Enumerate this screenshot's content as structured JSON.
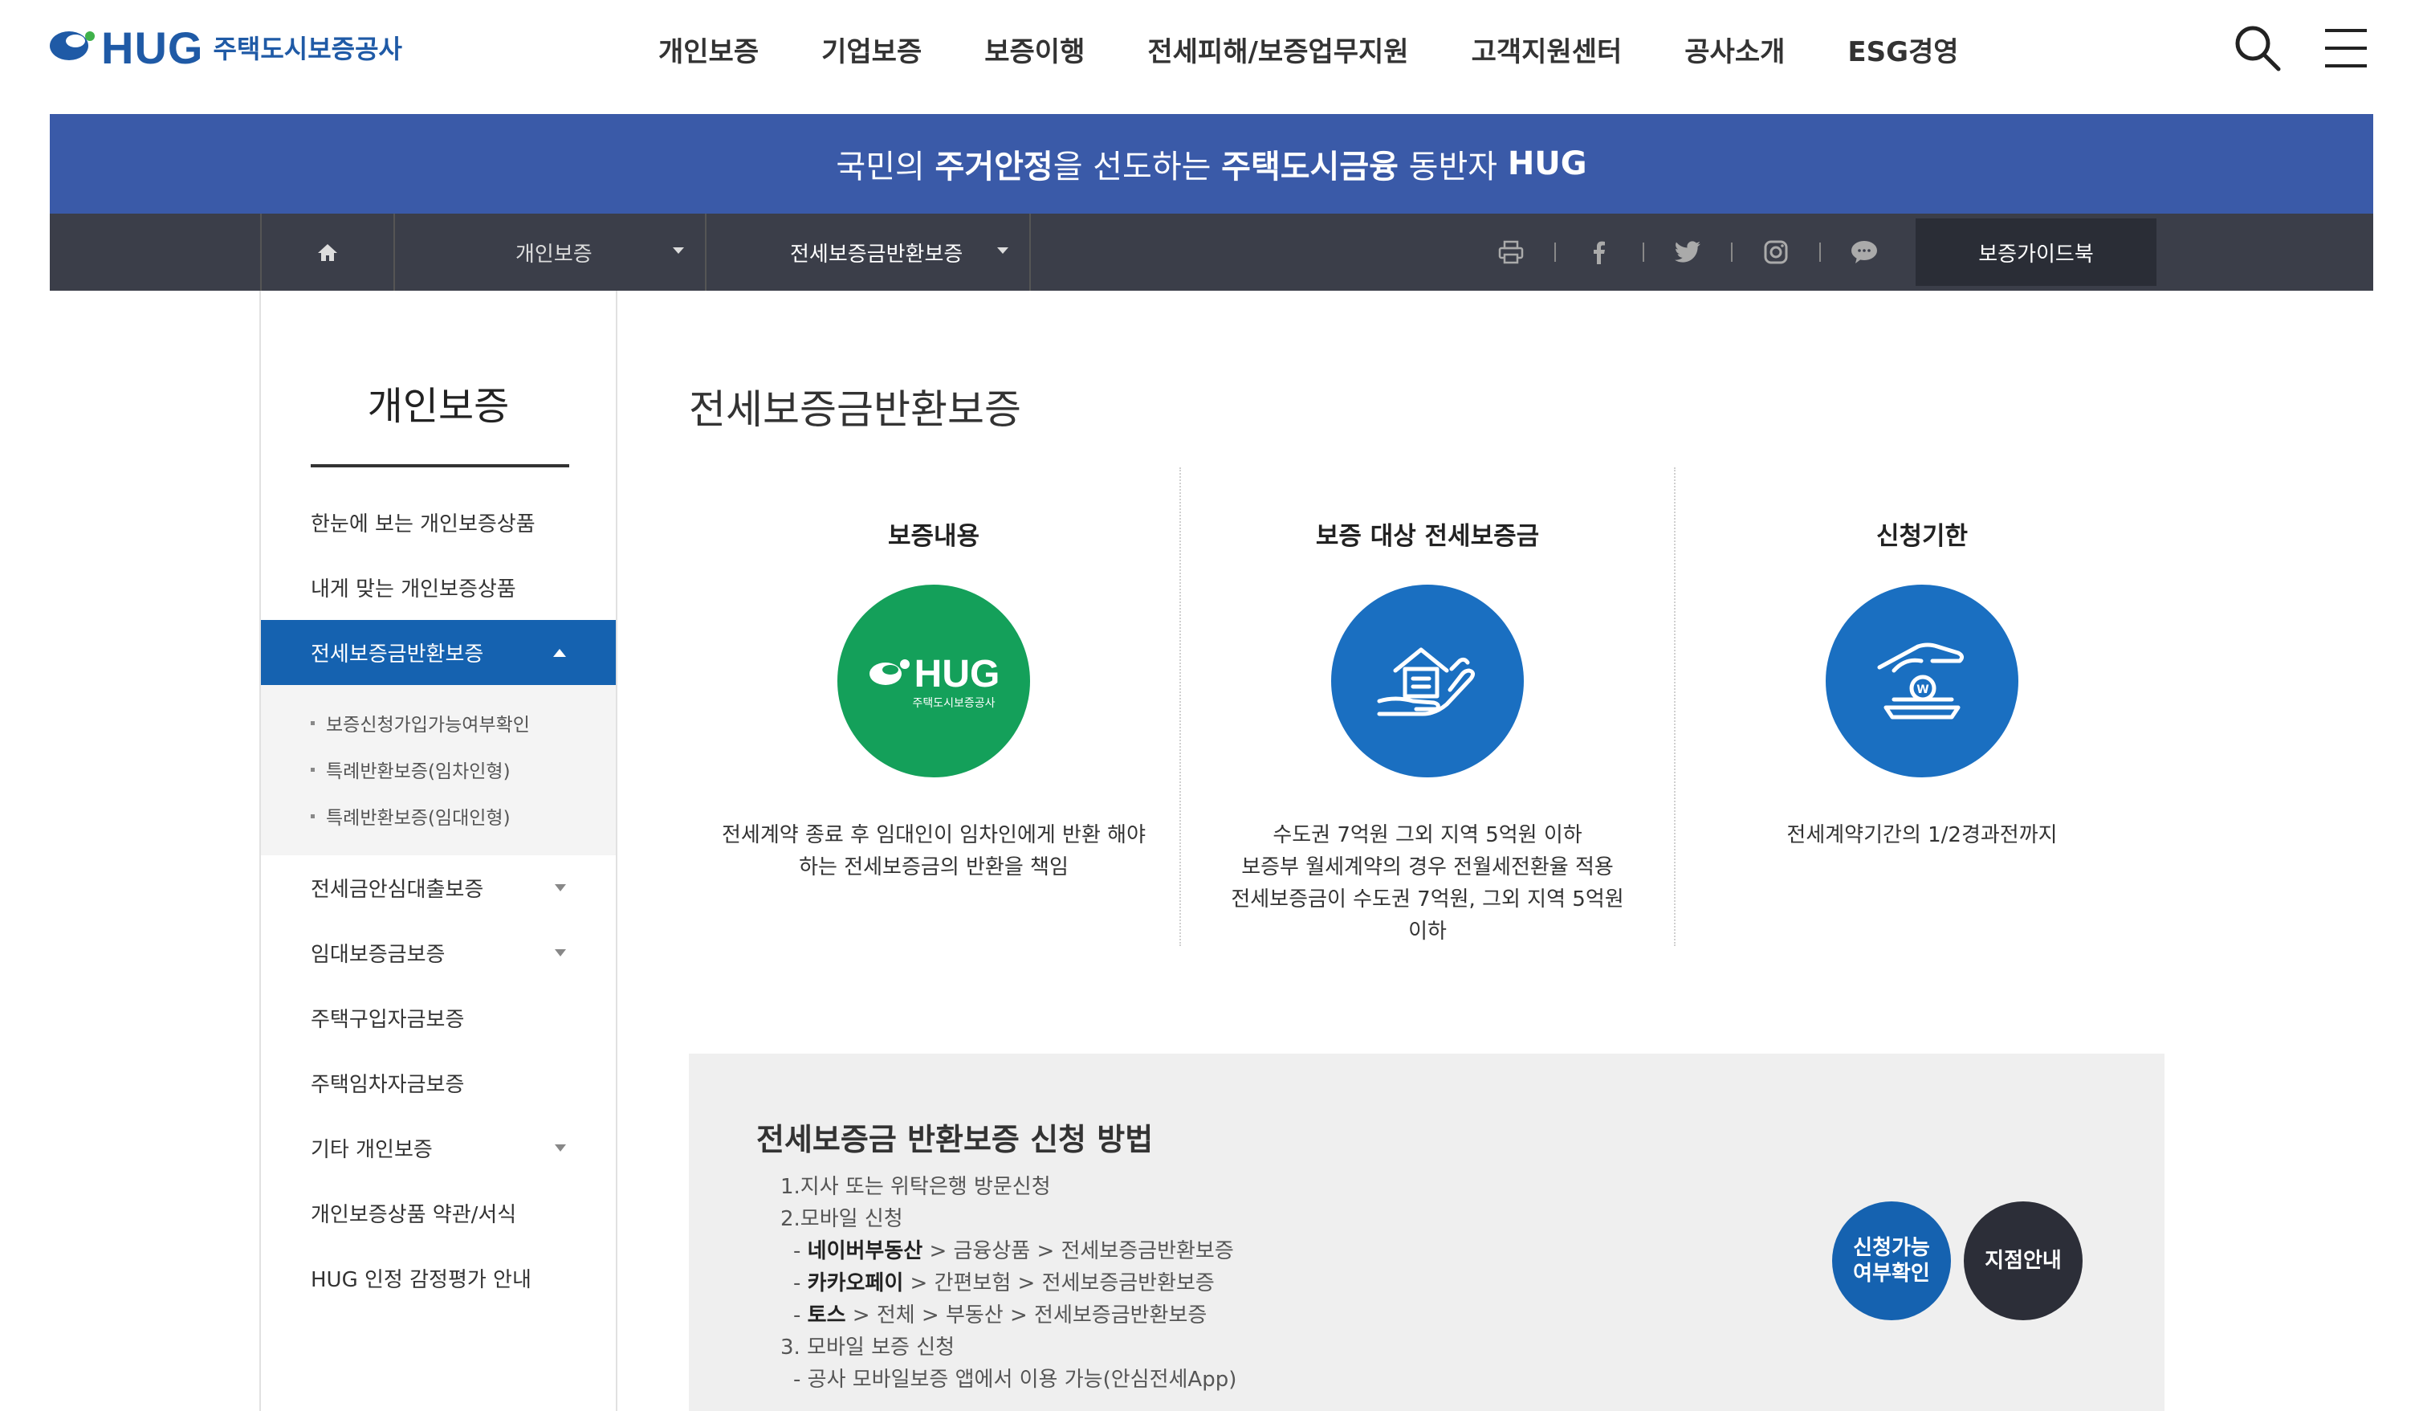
{
  "header": {
    "logo_text": "HUG",
    "logo_sub": "주택도시보증공사",
    "nav": [
      "개인보증",
      "기업보증",
      "보증이행",
      "전세피해/보증업무지원",
      "고객지원센터",
      "공사소개",
      "ESG경영"
    ]
  },
  "banner": {
    "part1": "국민의 ",
    "bold1": "주거안정",
    "part2": "을 선도하는 ",
    "bold2": "주택도시금융",
    "part3": " 동반자 ",
    "bold3": "HUG"
  },
  "subnav": {
    "dropdown1": "개인보증",
    "dropdown2": "전세보증금반환보증",
    "guide_label": "보증가이드북"
  },
  "sidebar": {
    "title": "개인보증",
    "items": [
      {
        "label": "한눈에 보는 개인보증상품"
      },
      {
        "label": "내게 맞는 개인보증상품"
      },
      {
        "label": "전세보증금반환보증"
      },
      {
        "label": "전세금안심대출보증"
      },
      {
        "label": "임대보증금보증"
      },
      {
        "label": "주택구입자금보증"
      },
      {
        "label": "주택임차자금보증"
      },
      {
        "label": "기타 개인보증"
      },
      {
        "label": "개인보증상품 약관/서식"
      },
      {
        "label": "HUG 인정 감정평가 안내"
      }
    ],
    "sub_items": [
      "보증신청가입가능여부확인",
      "특례반환보증(임차인형)",
      "특례반환보증(임대인형)"
    ]
  },
  "main": {
    "title": "전세보증금반환보증",
    "columns": [
      {
        "title": "보증내용",
        "desc_line1": "전세계약 종료 후 임대인이 임차인에게 반환 해야",
        "desc_line2": "하는 전세보증금의 반환을 책임",
        "logo_text": "HUG",
        "logo_sub": "주택도시보증공사"
      },
      {
        "title": "보증 대상 전세보증금",
        "desc_line1": "수도권 7억원 그외 지역 5억원 이하",
        "desc_line2": "보증부 월세계약의 경우 전월세전환율 적용",
        "desc_line3": "전세보증금이 수도권 7억원, 그외 지역 5억원",
        "desc_line4": "이하"
      },
      {
        "title": "신청기한",
        "desc_line1": "전세계약기간의 1/2경과전까지"
      }
    ],
    "coin_label": "W"
  },
  "howto": {
    "title": "전세보증금 반환보증 신청 방법",
    "line1": "1.지사 또는 위탁은행 방문신청",
    "line2": "2.모바일 신청",
    "naver_bold": "네이버부동산",
    "naver_rest": " > 금융상품 > 전세보증금반환보증",
    "kakao_bold": "카카오페이",
    "kakao_rest": " > 간편보험 > 전세보증금반환보증",
    "toss_bold": "토스",
    "toss_rest": " > 전체 > 부동산 > 전세보증금반환보증",
    "line3": "3. 모바일 보증 신청",
    "line4": "- 공사 모바일보증 앱에서 이용 가능(안심전세App)",
    "dash": "- ",
    "btn_check_line1": "신청가능",
    "btn_check_line2": "여부확인",
    "btn_branch": "지점안내"
  },
  "colors": {
    "brand_blue": "#1f5aa6",
    "banner": "#3a5aa8",
    "subnav": "#3b3e49",
    "active": "#1562b0",
    "green_circle": "#14a05a",
    "blue_circle": "#1a6fc1",
    "dark_button": "#2c2e38"
  }
}
